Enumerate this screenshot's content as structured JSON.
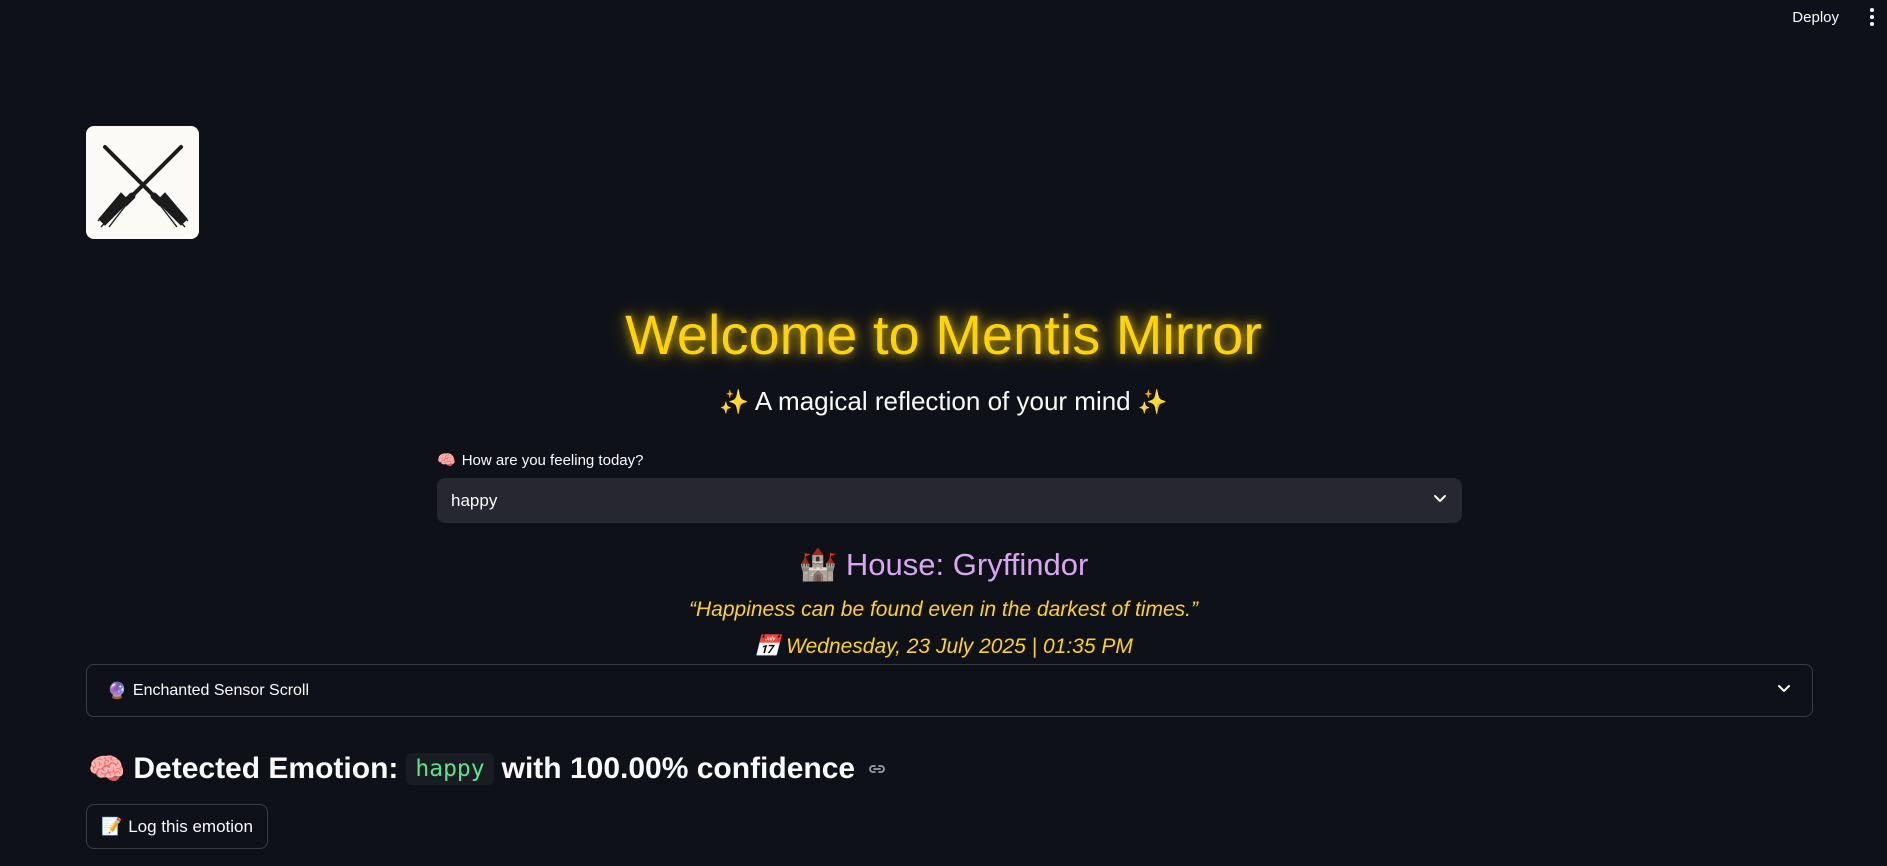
{
  "header": {
    "deploy_label": "Deploy",
    "menu_icon": "kebab-menu-icon"
  },
  "logo": {
    "icon": "crossed-broomsticks-icon"
  },
  "hero": {
    "title": "Welcome to Mentis Mirror",
    "subtitle": "A magical reflection of your mind",
    "sparkle": "✨",
    "title_color": "#ffd400"
  },
  "feeling": {
    "label_emoji": "🧠",
    "label": "How are you feeling today?",
    "selected": "happy"
  },
  "house": {
    "emoji": "🏰",
    "text": "House: Gryffindor",
    "color": "#d9a6f2"
  },
  "quote": "“Happiness can be found even in the darkest of times.”",
  "date": {
    "emoji": "📅",
    "text": "Wednesday, 23 July 2025 | 01:35 PM"
  },
  "expander": {
    "emoji": "🔮",
    "label": "Enchanted Sensor Scroll"
  },
  "detection": {
    "emoji": "🧠",
    "prefix": "Detected Emotion:",
    "emotion": "happy",
    "suffix": "with 100.00% confidence",
    "emotion_color": "#5ce488"
  },
  "log_button": {
    "emoji": "📝",
    "label": "Log this emotion"
  }
}
